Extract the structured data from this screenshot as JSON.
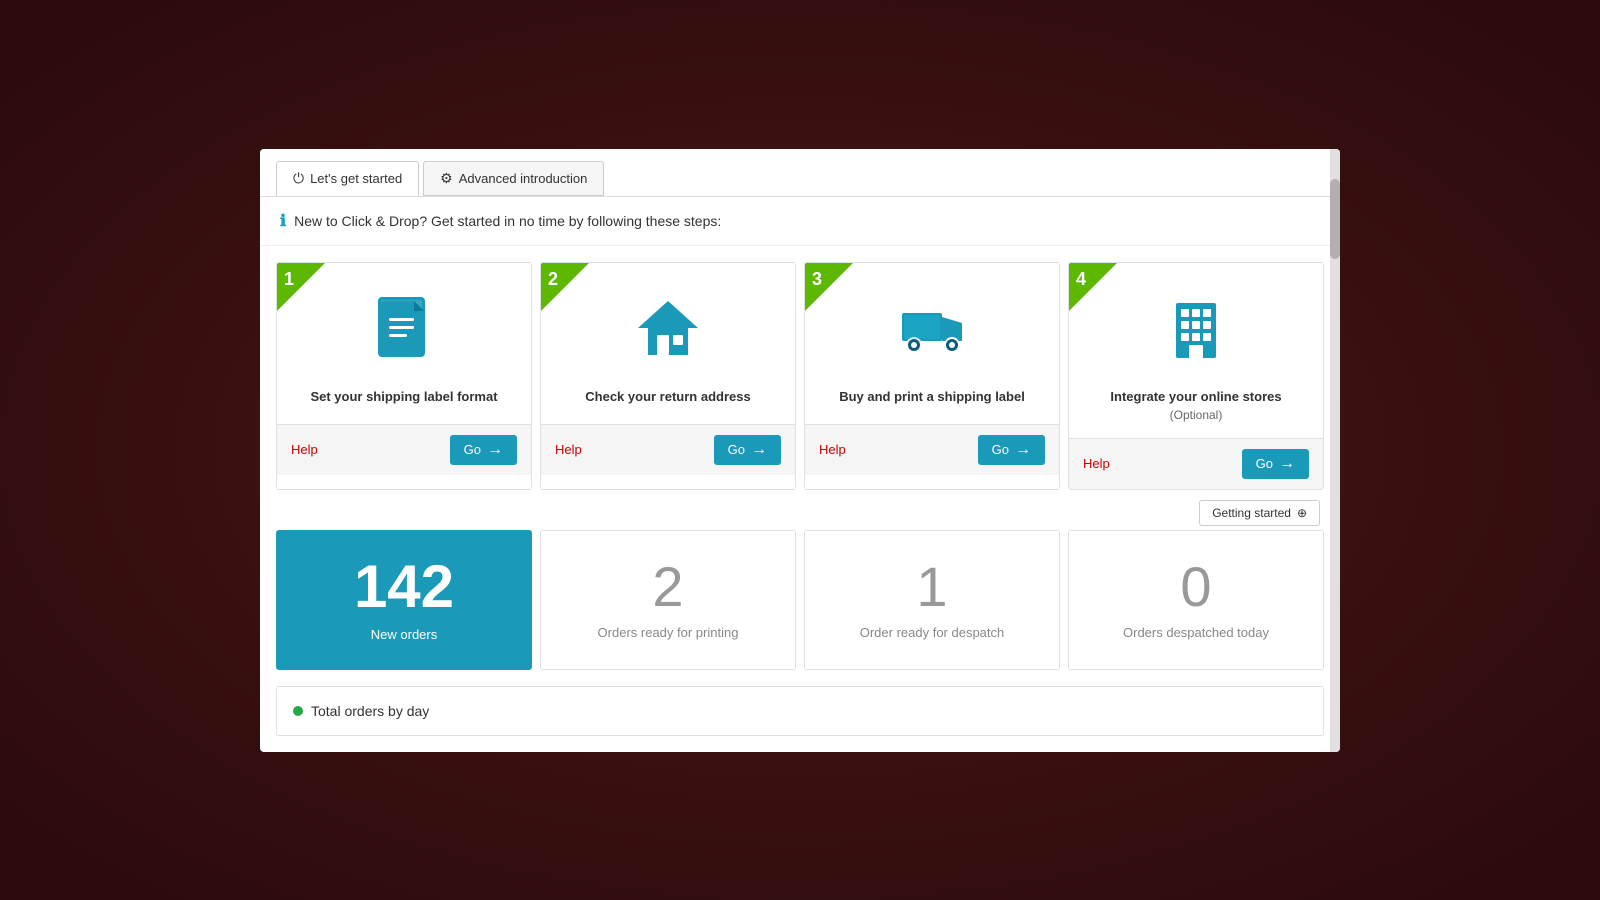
{
  "tabs": [
    {
      "id": "get-started",
      "label": "Let's get started",
      "icon": "⏻",
      "active": true
    },
    {
      "id": "advanced",
      "label": "Advanced introduction",
      "icon": "⚙",
      "active": false
    }
  ],
  "info_bar": {
    "text": "New to Click & Drop? Get started in no time by following these steps:"
  },
  "steps": [
    {
      "number": "1",
      "title": "Set your shipping label format",
      "subtitle": "",
      "help_label": "Help",
      "go_label": "Go"
    },
    {
      "number": "2",
      "title": "Check your return address",
      "subtitle": "",
      "help_label": "Help",
      "go_label": "Go"
    },
    {
      "number": "3",
      "title": "Buy and print a shipping label",
      "subtitle": "",
      "help_label": "Help",
      "go_label": "Go"
    },
    {
      "number": "4",
      "title": "Integrate your online stores",
      "subtitle": "(Optional)",
      "help_label": "Help",
      "go_label": "Go"
    }
  ],
  "getting_started_label": "Getting started",
  "stats": [
    {
      "value": "142",
      "label": "New orders",
      "highlighted": true
    },
    {
      "value": "2",
      "label": "Orders ready for printing",
      "highlighted": false
    },
    {
      "value": "1",
      "label": "Order ready for despatch",
      "highlighted": false
    },
    {
      "value": "0",
      "label": "Orders despatched today",
      "highlighted": false
    }
  ],
  "chart": {
    "dot_color": "#28a745",
    "title": "Total orders by day",
    "total_label": "Total"
  }
}
